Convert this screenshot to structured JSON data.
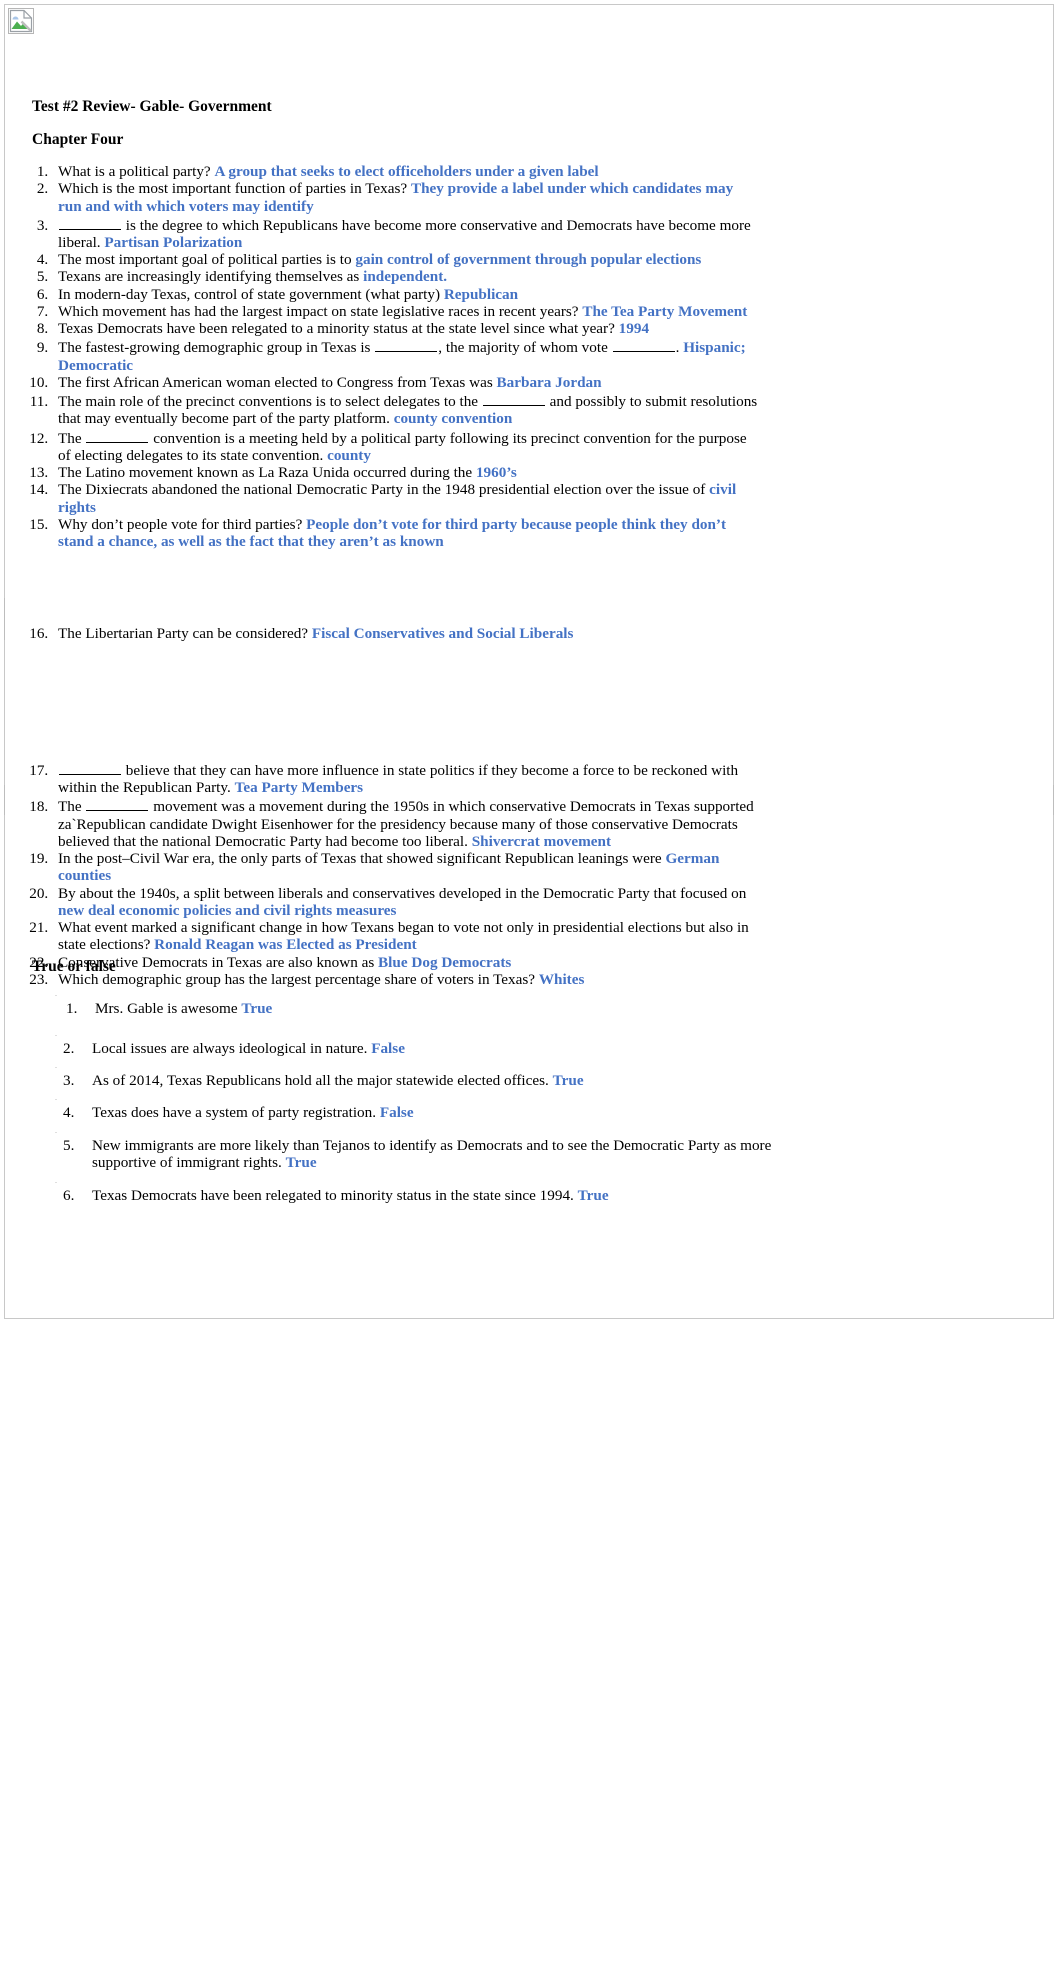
{
  "document": {
    "title": "Test #2 Review- Gable- Government",
    "chapter_heading": "Chapter Four",
    "true_false_heading": "True or false",
    "answer_color": "#4472C4",
    "broken_image_alt": "broken-image-placeholder"
  },
  "questions_part1": [
    {
      "n": 1,
      "q": "What is a political party? ",
      "a": "A group that seeks to elect officeholders under a given label"
    },
    {
      "n": 2,
      "q": "Which is the most important function of parties in Texas? ",
      "a": "They provide a label under which candidates may run and with which voters may identify"
    },
    {
      "n": 3,
      "q_pre": "",
      "blank": true,
      "q": " is the degree to which Republicans have become more conservative and Democrats have become more liberal. ",
      "a": "Partisan Polarization"
    },
    {
      "n": 4,
      "q": "The most important goal of political parties is to ",
      "a": "gain control of government through popular elections"
    },
    {
      "n": 5,
      "q": "Texans are increasingly identifying themselves as ",
      "a": "independent."
    },
    {
      "n": 6,
      "q": "In modern-day Texas, control of state government (what party) ",
      "a": "Republican"
    },
    {
      "n": 7,
      "q": "Which movement has had the largest impact on state legislative races in recent years? ",
      "a": "The Tea Party Movement"
    },
    {
      "n": 8,
      "q": "Texas Democrats have been relegated to a minority status at the state level since what year? ",
      "a": "1994"
    },
    {
      "n": 9,
      "q_pre": "The fastest-growing demographic group in Texas is ",
      "q_mid": ", the majority of whom vote ",
      "q_post": ". ",
      "two_blanks": true,
      "a": "Hispanic; Democratic"
    },
    {
      "n": 10,
      "q": "The first African American woman elected to Congress from Texas was ",
      "a": "Barbara Jordan"
    },
    {
      "n": 11,
      "q_pre": "The main role of the precinct conventions is to select delegates to the ",
      "q_post": " and possibly to submit resolutions that may eventually become part of the party platform. ",
      "one_blank": true,
      "a": "county convention"
    },
    {
      "n": 12,
      "q_pre": "The ",
      "q_post": " convention is a meeting held by a political party following its precinct convention for the purpose of electing delegates to its state convention. ",
      "one_blank": true,
      "a": "county"
    },
    {
      "n": 13,
      "q": "The Latino movement known as La Raza Unida occurred during the ",
      "a": "1960’s"
    },
    {
      "n": 14,
      "q": "The Dixiecrats abandoned the national Democratic Party in the 1948 presidential election over the issue of ",
      "a": "civil rights"
    },
    {
      "n": 15,
      "q": "Why don’t people vote for third parties? ",
      "a": "People don’t vote for third party because people think they don’t stand a chance, as well as the fact that they aren’t as known"
    }
  ],
  "questions_part2": [
    {
      "n": 16,
      "q": "The Libertarian Party can be considered? ",
      "a": "Fiscal Conservatives and Social Liberals"
    }
  ],
  "questions_part3": [
    {
      "n": 17,
      "q_pre": "",
      "q_post": " believe that they can have more influence in state politics if they become a force to be reckoned with within the Republican Party. ",
      "one_blank": true,
      "a": "Tea Party Members"
    },
    {
      "n": 18,
      "q_pre": "The ",
      "q_post": " movement was a movement during the 1950s in which conservative Democrats in Texas supported za`Republican candidate Dwight Eisenhower for the presidency because many of those conservative Democrats believed that the national Democratic Party had become too liberal. ",
      "one_blank": true,
      "a": "Shivercrat movement"
    },
    {
      "n": 19,
      "q": "In the post–Civil War era, the only parts of Texas that showed significant Republican leanings were ",
      "a": "German counties"
    },
    {
      "n": 20,
      "q": "By about the 1940s, a split between liberals and conservatives developed in the Democratic Party that focused on ",
      "a": "new deal economic policies and civil rights measures"
    },
    {
      "n": 21,
      "q": "What event marked a significant change in how Texans began to vote not only in presidential elections but also in state elections? ",
      "a": "Ronald Reagan was Elected as President"
    },
    {
      "n": 22,
      "q": "Conservative Democrats in Texas are also known as ",
      "a": "Blue Dog Democrats"
    },
    {
      "n": 23,
      "q": "Which demographic group has the largest percentage share of voters in Texas? ",
      "a": "Whites"
    }
  ],
  "true_false": [
    {
      "n": "1.",
      "q": "Mrs. Gable is awesome ",
      "a": "True"
    },
    {
      "n": "2.",
      "q": "Local issues are always ideological in nature. ",
      "a": "False"
    },
    {
      "n": "3.",
      "q": "As of 2014, Texas Republicans hold all the major statewide elected offices. ",
      "a": "True"
    },
    {
      "n": "4.",
      "q": "Texas does have a system of party registration. ",
      "a": "False"
    },
    {
      "n": "5.",
      "q": "New immigrants are more likely than Tejanos to identify as Democrats and to see the Democratic Party as more supportive of immigrant rights. ",
      "a": "True"
    },
    {
      "n": "6.",
      "q": "Texas Democrats have been relegated to minority status in the state since 1994. ",
      "a": "True"
    }
  ]
}
